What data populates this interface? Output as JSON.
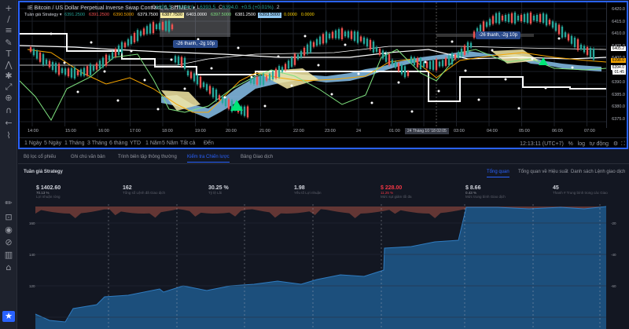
{
  "left_toolbar": {
    "icons": [
      {
        "name": "crosshair-icon",
        "glyph": "+"
      },
      {
        "name": "trend-line-icon",
        "glyph": "/"
      },
      {
        "name": "horizontal-line-icon",
        "glyph": "≡"
      },
      {
        "name": "brush-icon",
        "glyph": "✎"
      },
      {
        "name": "text-tool-icon",
        "glyph": "T"
      },
      {
        "name": "pattern-icon",
        "glyph": "⋀"
      },
      {
        "name": "prediction-icon",
        "glyph": "✱"
      },
      {
        "name": "measure-icon",
        "glyph": "⤢"
      },
      {
        "name": "zoom-icon",
        "glyph": "⊕"
      },
      {
        "name": "magnet-icon",
        "glyph": "∩"
      },
      {
        "name": "back-icon",
        "glyph": "←"
      },
      {
        "name": "ruler-icon",
        "glyph": "⌇"
      },
      {
        "name": "pencil-icon",
        "glyph": "✏"
      },
      {
        "name": "lock-icon",
        "glyph": "⊡"
      },
      {
        "name": "eye-icon",
        "glyph": "◉"
      },
      {
        "name": "link-icon",
        "glyph": "⊘"
      },
      {
        "name": "trash-icon",
        "glyph": "▥"
      },
      {
        "name": "tree-icon",
        "glyph": "⌂"
      }
    ]
  },
  "chart": {
    "symbol_title": "IE Bitcoin / US Dollar Perpetual Inverse Swap Contract, 5, BITMEX",
    "ohlc": [
      {
        "label": "O",
        "value": "6393.5"
      },
      {
        "label": "H",
        "value": "6394.0"
      },
      {
        "label": "L",
        "value": "6393.5"
      },
      {
        "label": "C",
        "value": "6394.0"
      },
      {
        "label": "",
        "value": "+0.5 (+0.01%)"
      }
    ],
    "counter": "2",
    "study": {
      "name": "Tuần giá Strategy",
      "values": [
        {
          "text": "6391.2500",
          "color": "#26a69a",
          "bg": "transparent"
        },
        {
          "text": "6391.2500",
          "color": "#ff5252",
          "bg": "transparent"
        },
        {
          "text": "6390.5000",
          "color": "#f7a600",
          "bg": "transparent"
        },
        {
          "text": "6379.7500",
          "color": "#ffffff",
          "bg": "transparent"
        },
        {
          "text": "6387.7500",
          "color": "#000000",
          "bg": "#f3e9a0"
        },
        {
          "text": "6403.0000",
          "color": "#ffffff",
          "bg": "transparent"
        },
        {
          "text": "6397.5000",
          "color": "#7fe27f",
          "bg": "transparent"
        },
        {
          "text": "6381.2500",
          "color": "#ffffff",
          "bg": "transparent"
        },
        {
          "text": "6393.5000",
          "color": "#000000",
          "bg": "#90c6ef"
        },
        {
          "text": "0.0000",
          "color": "#ffd400",
          "bg": "transparent"
        },
        {
          "text": "0.0000",
          "color": "#ffd400",
          "bg": "transparent"
        }
      ]
    },
    "callouts": [
      "-26 thanh, -2g 10p",
      "-26 thanh, -2g 10p"
    ],
    "price_ticks": [
      "6420.0",
      "6415.0",
      "6410.0",
      "6405.0",
      "6400.0",
      "6395.0",
      "6390.0",
      "6385.0",
      "6380.0",
      "6375.0"
    ],
    "price_tags": [
      {
        "text": "6405.2",
        "color": "#ffffff"
      },
      {
        "text": "6398.0",
        "color": "#f7a600"
      },
      {
        "text": "6394.0",
        "color": "#ffffff"
      },
      {
        "text": "01:45",
        "color": "#ffffff"
      }
    ],
    "time_ticks": [
      "14:00",
      "15:00",
      "16:00",
      "17:00",
      "18:00",
      "19:00",
      "20:00",
      "21:00",
      "22:00",
      "23:00",
      "24",
      "01:00",
      "03:00",
      "04:00",
      "05:00",
      "06:00",
      "07:00"
    ],
    "crosshair_time": "24 Tháng 10 '18  02:05",
    "ranges": [
      "1 Ngày",
      "5 Ngày",
      "1 Tháng",
      "3 Tháng",
      "6 tháng",
      "YTD",
      "1 Năm",
      "5 Năm",
      "Tất cả",
      "Đến"
    ],
    "clock": "12:13:11 (UTC+7)",
    "scale_options": [
      "%",
      "log",
      "tự động"
    ]
  },
  "panel_tabs": [
    {
      "label": "Bộ lọc cổ phiếu",
      "active": false
    },
    {
      "label": "Ghi chú văn bản",
      "active": false
    },
    {
      "label": "Trình biên tập thông thường",
      "active": false
    },
    {
      "label": "Kiểm tra Chiến lược",
      "active": true
    },
    {
      "label": "Bảng Giao dịch",
      "active": false
    }
  ],
  "report": {
    "strategy_name": "Tuần giá Strategy",
    "tabs": [
      {
        "label": "Tổng quan",
        "active": true
      },
      {
        "label": "Tổng quan về Hiệu suất",
        "active": false
      },
      {
        "label": "Danh sách Lệnh giao dịch",
        "active": false
      }
    ],
    "metrics": [
      {
        "value": "$ 1402.60",
        "sub": "70.13 %",
        "label": "Lợi nhuận ròng",
        "negative": false
      },
      {
        "value": "162",
        "sub": "",
        "label": "Tổng số Lệnh đã Giao dịch",
        "negative": false
      },
      {
        "value": "30.25 %",
        "sub": "",
        "label": "Tỷ lệ Lãi",
        "negative": false
      },
      {
        "value": "1.98",
        "sub": "",
        "label": "Yếu tố Lợi nhuận",
        "negative": false
      },
      {
        "value": "$ 228.00",
        "sub": "11.25 %",
        "label": "Mức sụt giảm tối đa",
        "negative": true
      },
      {
        "value": "$ 8.66",
        "sub": "0.43 %",
        "label": "Mức trung bình Giao dịch",
        "negative": false
      },
      {
        "value": "45",
        "sub": "",
        "label": "Thanh # Trung bình trong các Giao",
        "negative": false
      }
    ],
    "equity_ticks_left": [
      "160",
      "140",
      "120"
    ],
    "equity_ticks_right": [
      "-20",
      "-40",
      "-60"
    ]
  }
}
